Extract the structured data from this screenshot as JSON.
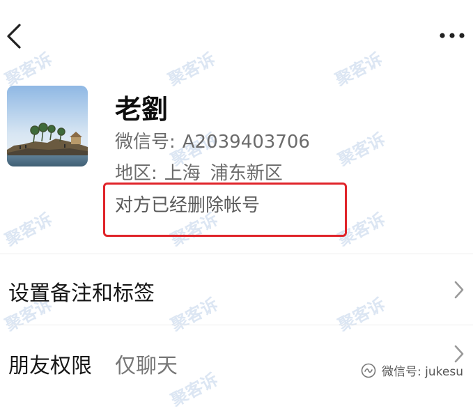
{
  "nav": {
    "back_icon": "chevron-left-icon",
    "more_icon": "ellipsis-icon"
  },
  "profile": {
    "name": "老劉",
    "wechat_id_label": "微信号:",
    "wechat_id": "A2039403706",
    "region_label": "地区:",
    "region_province": "上海",
    "region_district": "浦东新区",
    "deleted_notice": "对方已经删除帐号"
  },
  "menu": {
    "remarks_label": "设置备注和标签",
    "permission_label": "朋友权限",
    "permission_value": "仅聊天"
  },
  "watermark": {
    "text": "聚客诉"
  },
  "brand": {
    "icon": "wechat-official-icon",
    "label": "微信号: jukesu"
  },
  "colors": {
    "highlight_border": "#e0242a",
    "watermark": "#608cc8"
  }
}
